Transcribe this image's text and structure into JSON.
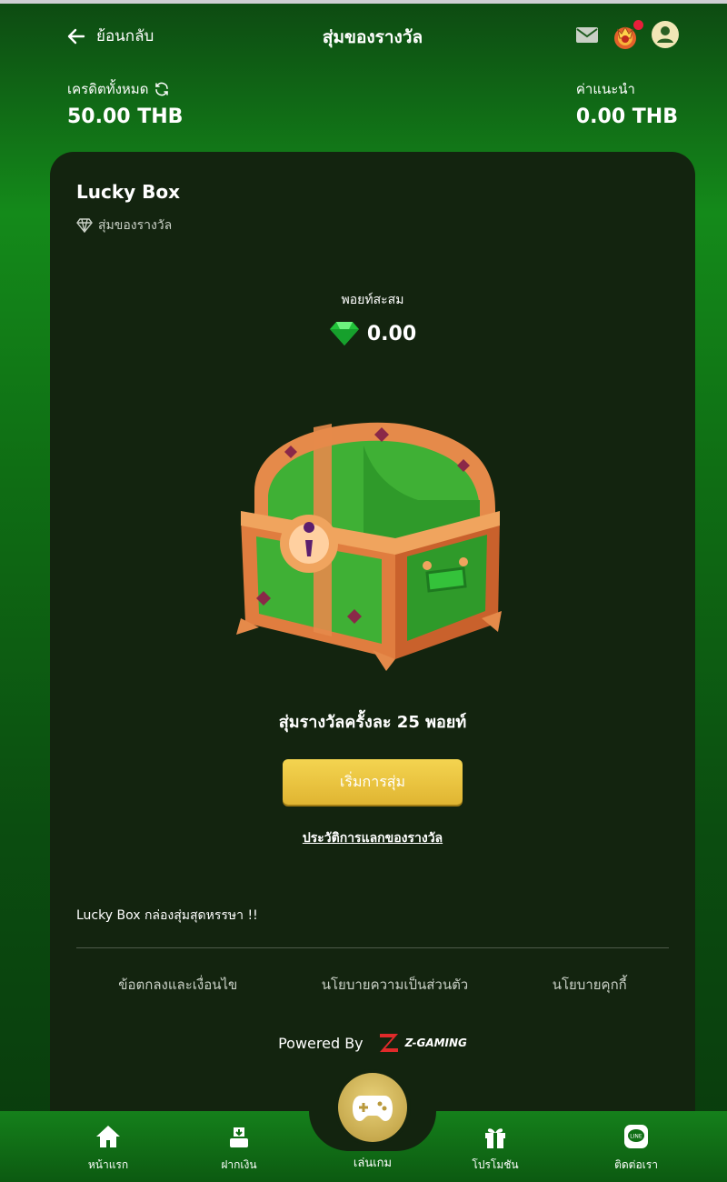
{
  "header": {
    "back_label": "ย้อนกลับ",
    "title": "สุ่มของรางวัล",
    "icons": [
      "mail-icon",
      "rank-badge-icon",
      "profile-icon"
    ]
  },
  "balance": {
    "label": "เครดิตทั้งหมด",
    "value": "50.00 THB"
  },
  "referral": {
    "label": "ค่าแนะนำ",
    "value": "0.00 THB"
  },
  "card": {
    "title": "Lucky Box",
    "subtitle": "สุ่มของรางวัล",
    "points_label": "พอยท์สะสม",
    "points_value": "0.00",
    "cost_text": "สุ่มรางวัลครั้งละ 25 พอยท์",
    "start_button": "เริ่มการสุ่ม",
    "history_link": "ประวัติการแลกของรางวัล",
    "promo_text": "Lucky Box กล่องสุ่มสุดหรรษา !!"
  },
  "footer": {
    "links": [
      "ข้อตกลงและเงื่อนไข",
      "นโยบายความเป็นส่วนตัว",
      "นโยบายคุกกี้"
    ],
    "powered_by": "Powered By",
    "brand": "Z-GAMING"
  },
  "bottom_nav": {
    "items": [
      {
        "label": "หน้าแรก",
        "icon": "home-icon"
      },
      {
        "label": "ฝากเงิน",
        "icon": "deposit-icon"
      },
      {
        "label": "เล่นเกม",
        "icon": "gamepad-icon"
      },
      {
        "label": "โปรโมชัน",
        "icon": "gift-icon"
      },
      {
        "label": "ติดต่อเรา",
        "icon": "line-chat-icon"
      }
    ]
  },
  "colors": {
    "accent_gold": "#e0b532",
    "card_bg": "#13240f",
    "gem_green": "#22c33a",
    "notification": "#e81e3a"
  }
}
